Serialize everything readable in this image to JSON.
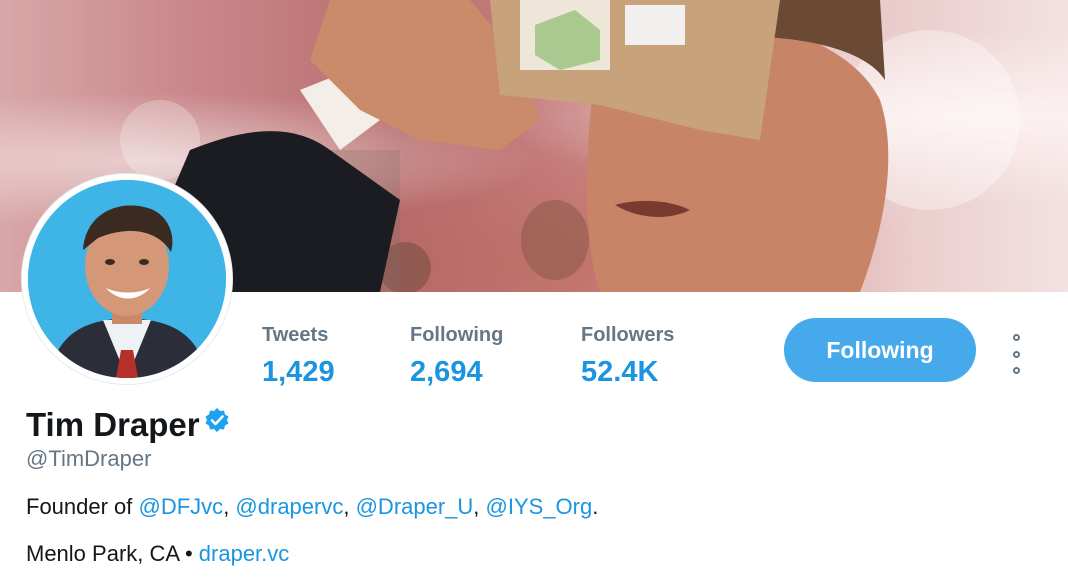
{
  "profile": {
    "name": "Tim Draper",
    "handle": "@TimDraper",
    "verified_icon": "verified-badge-icon",
    "bio": {
      "prefix": "Founder of ",
      "mentions": [
        "@DFJvc",
        "@drapervc",
        "@Draper_U",
        "@IYS_Org"
      ],
      "separator": ", ",
      "suffix": "."
    },
    "location": "Menlo Park, CA",
    "meta_separator": " • ",
    "website": "draper.vc"
  },
  "stats": {
    "tweets_label": "Tweets",
    "tweets_value": "1,429",
    "following_label": "Following",
    "following_value": "2,694",
    "followers_label": "Followers",
    "followers_value": "52.4K"
  },
  "actions": {
    "follow_button_label": "Following",
    "more_icon": "more-vertical-icon"
  },
  "colors": {
    "accent": "#1b95e0",
    "button": "#45a9eb",
    "secondary_text": "#657786",
    "primary_text": "#14171a"
  }
}
